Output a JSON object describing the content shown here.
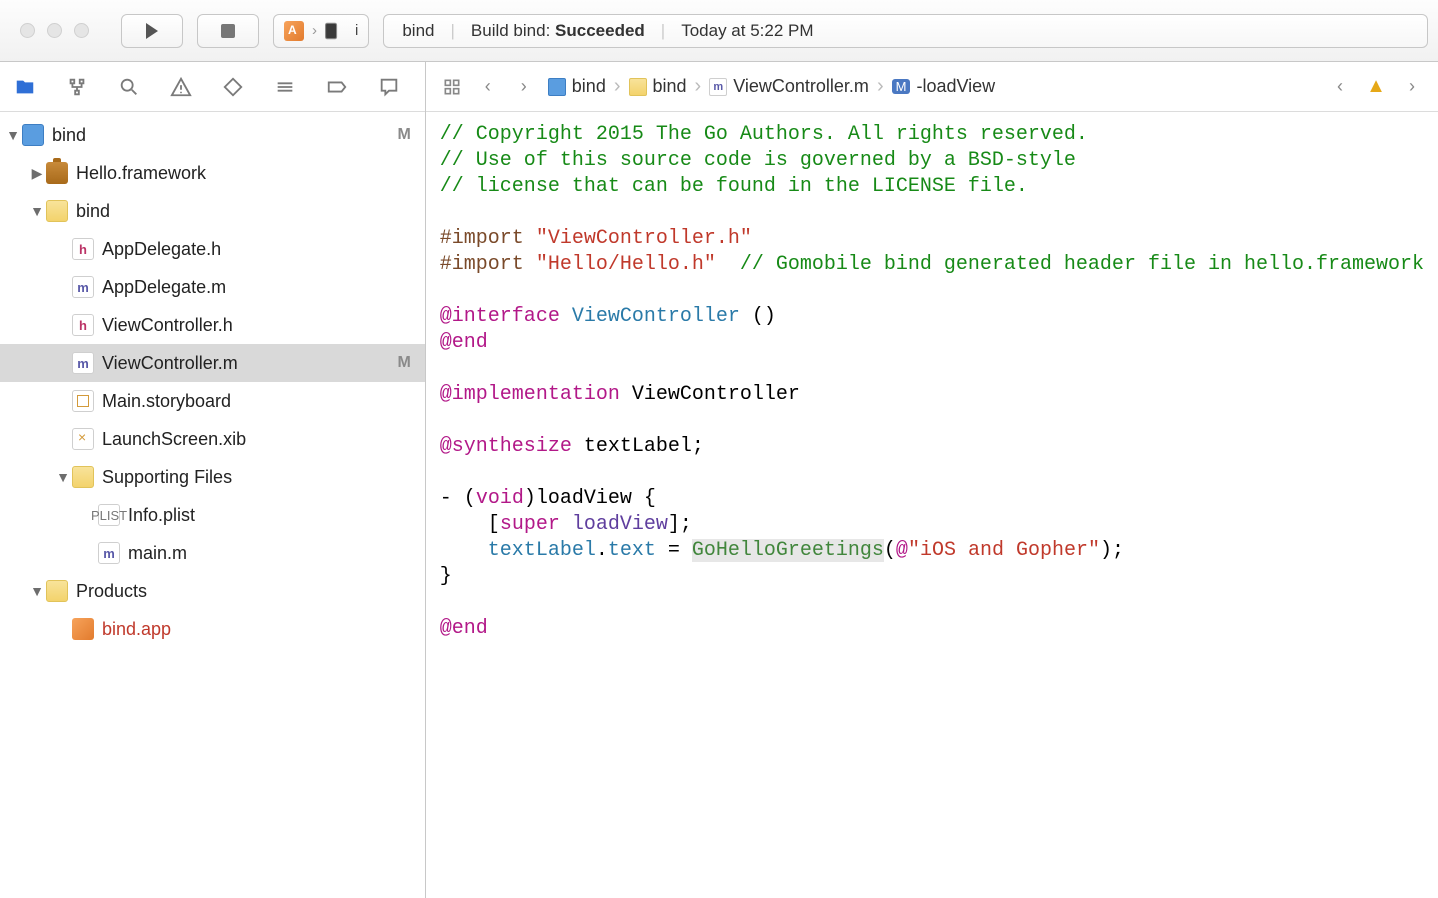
{
  "toolbar": {
    "scheme_label": "i",
    "activity_project": "bind",
    "activity_prefix": "Build bind: ",
    "activity_status": "Succeeded",
    "activity_time": "Today at 5:22 PM"
  },
  "breadcrumb": {
    "project": "bind",
    "folder": "bind",
    "file": "ViewController.m",
    "symbol": "-loadView"
  },
  "tree": {
    "root": {
      "name": "bind",
      "badge": "M"
    },
    "hello_fw": {
      "name": "Hello.framework"
    },
    "bindf": {
      "name": "bind"
    },
    "appdel_h": {
      "name": "AppDelegate.h"
    },
    "appdel_m": {
      "name": "AppDelegate.m"
    },
    "vc_h": {
      "name": "ViewController.h"
    },
    "vc_m": {
      "name": "ViewController.m",
      "badge": "M"
    },
    "mainsb": {
      "name": "Main.storyboard"
    },
    "launch": {
      "name": "LaunchScreen.xib"
    },
    "supp": {
      "name": "Supporting Files"
    },
    "info": {
      "name": "Info.plist"
    },
    "mainm": {
      "name": "main.m"
    },
    "products": {
      "name": "Products"
    },
    "bindapp": {
      "name": "bind.app"
    }
  },
  "code": {
    "c1": "// Copyright 2015 The Go Authors. All rights reserved.",
    "c2": "// Use of this source code is governed by a BSD-style",
    "c3": "// license that can be found in the LICENSE file.",
    "imp": "#import",
    "s1": "\"ViewController.h\"",
    "s2": "\"Hello/Hello.h\"",
    "c4": "// Gomobile bind generated header file in hello.framework",
    "iface": "@interface",
    "vc": "ViewController",
    "parens": " ()",
    "end": "@end",
    "impl": "@implementation",
    "synth": "@synthesize",
    "tl": " textLabel;",
    "dash": "- (",
    "void": "void",
    "load1": ")loadView {",
    "lbrac": "    [",
    "super": "super",
    "loadv": "loadView",
    "rbrac": "];",
    "tltxt": "    textLabel",
    "dottxt": ".",
    "textprop": "text",
    "eq": " = ",
    "gohello": "GoHelloGreetings",
    "lp": "(",
    "at": "@",
    "s3": "\"iOS and Gopher\"",
    "rp": ");",
    "rbrace": "}"
  }
}
